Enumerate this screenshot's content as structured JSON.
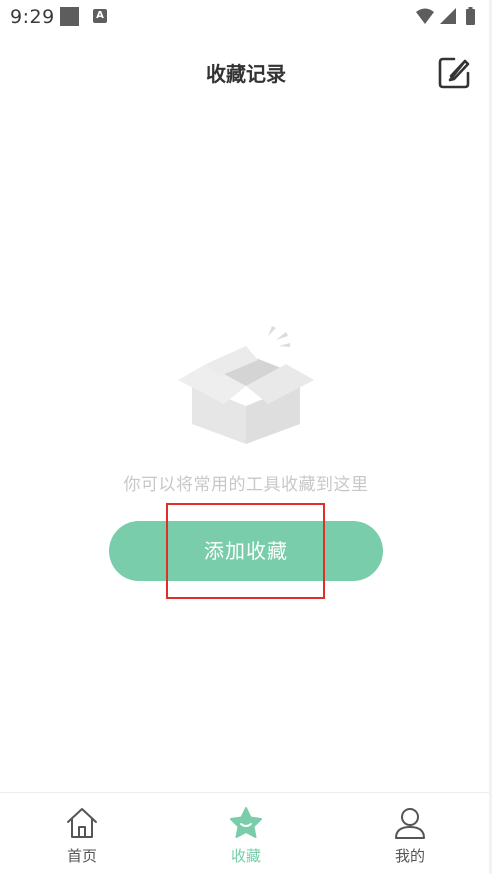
{
  "status_bar": {
    "time": "9:29",
    "notification_icons": [
      "square-icon",
      "a-icon"
    ],
    "status_icons": [
      "wifi-icon",
      "signal-icon",
      "battery-icon"
    ]
  },
  "header": {
    "title": "收藏记录",
    "edit_icon": "edit-icon"
  },
  "empty_state": {
    "illustration": "empty-box-icon",
    "message": "你可以将常用的工具收藏到这里",
    "add_button_label": "添加收藏"
  },
  "bottom_nav": {
    "items": [
      {
        "label": "首页",
        "icon": "home-icon",
        "active": false
      },
      {
        "label": "收藏",
        "icon": "star-icon",
        "active": true
      },
      {
        "label": "我的",
        "icon": "user-icon",
        "active": false
      }
    ]
  },
  "colors": {
    "accent": "#7acdaa",
    "highlight": "#e02f2a",
    "muted_text": "#c8c8c8",
    "icon_gray": "#5d5d5d"
  }
}
